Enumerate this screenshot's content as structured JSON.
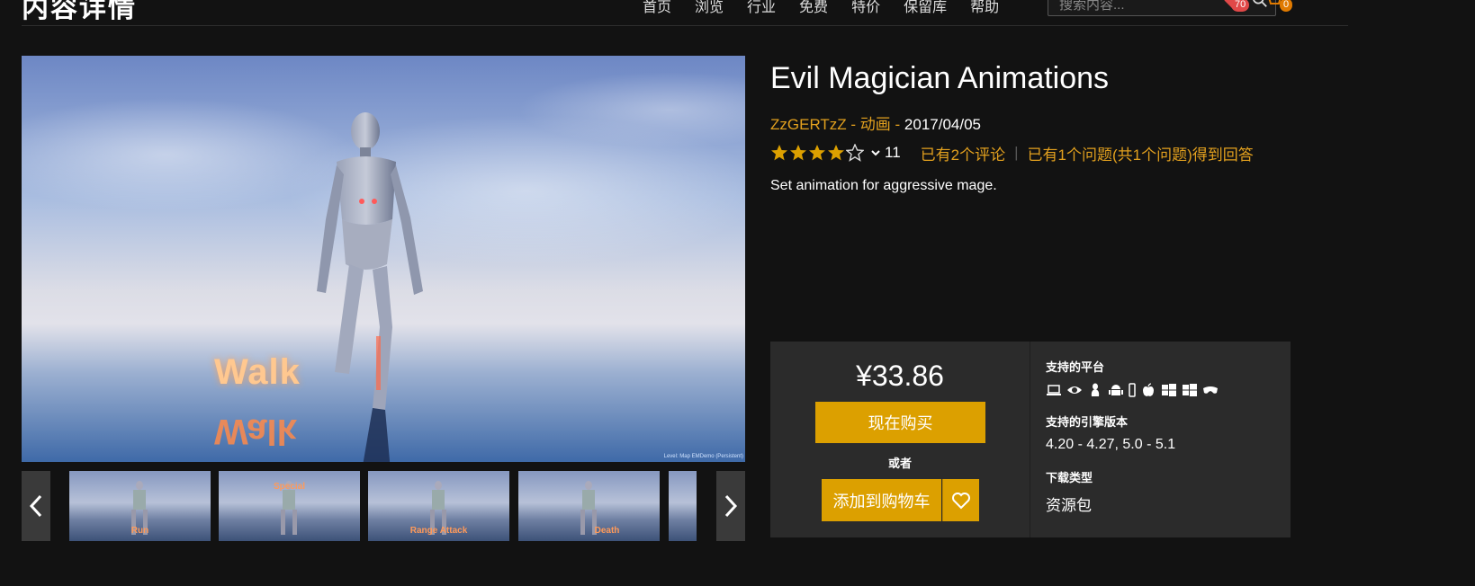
{
  "header": {
    "title": "内容详情",
    "nav": [
      "首页",
      "浏览",
      "行业",
      "免费",
      "特价",
      "保留库",
      "帮助"
    ],
    "search_placeholder": "搜索内容...",
    "wishlist_count": "70",
    "cart_count": "0"
  },
  "hero": {
    "overlay_word": "Walk",
    "caption": "Level: Map EMDemo (Persistent)"
  },
  "thumbnails": [
    {
      "label": "Run"
    },
    {
      "label": "Special"
    },
    {
      "label": "Range Attack"
    },
    {
      "label": "Death"
    },
    {
      "label": ""
    }
  ],
  "product": {
    "title": "Evil Magician Animations",
    "author": "ZzGERTzZ",
    "category": "动画",
    "date": "2017/04/05",
    "separator": " - ",
    "rating": 4,
    "rating_max": 5,
    "rating_count": "11",
    "reviews_link": "已有2个评论",
    "questions_link": "已有1个问题(共1个问题)得到回答",
    "description": "Set animation for aggressive mage."
  },
  "purchase": {
    "price": "¥33.86",
    "buy_label": "现在购买",
    "or_label": "或者",
    "cart_label": "添加到购物车",
    "platforms_heading": "支持的平台",
    "platform_icons": [
      "laptop-icon",
      "eye-icon",
      "linux-icon",
      "android-icon",
      "phone-icon",
      "apple-icon",
      "windows-icon",
      "windows-icon",
      "vr-headset-icon"
    ],
    "engine_heading": "支持的引擎版本",
    "engine_versions": "4.20 - 4.27, 5.0 - 5.1",
    "download_heading": "下载类型",
    "download_type": "资源包"
  },
  "colors": {
    "accent": "#dca000",
    "link": "#e2a01e",
    "background": "#121212",
    "panel": "#2b2b2b"
  }
}
